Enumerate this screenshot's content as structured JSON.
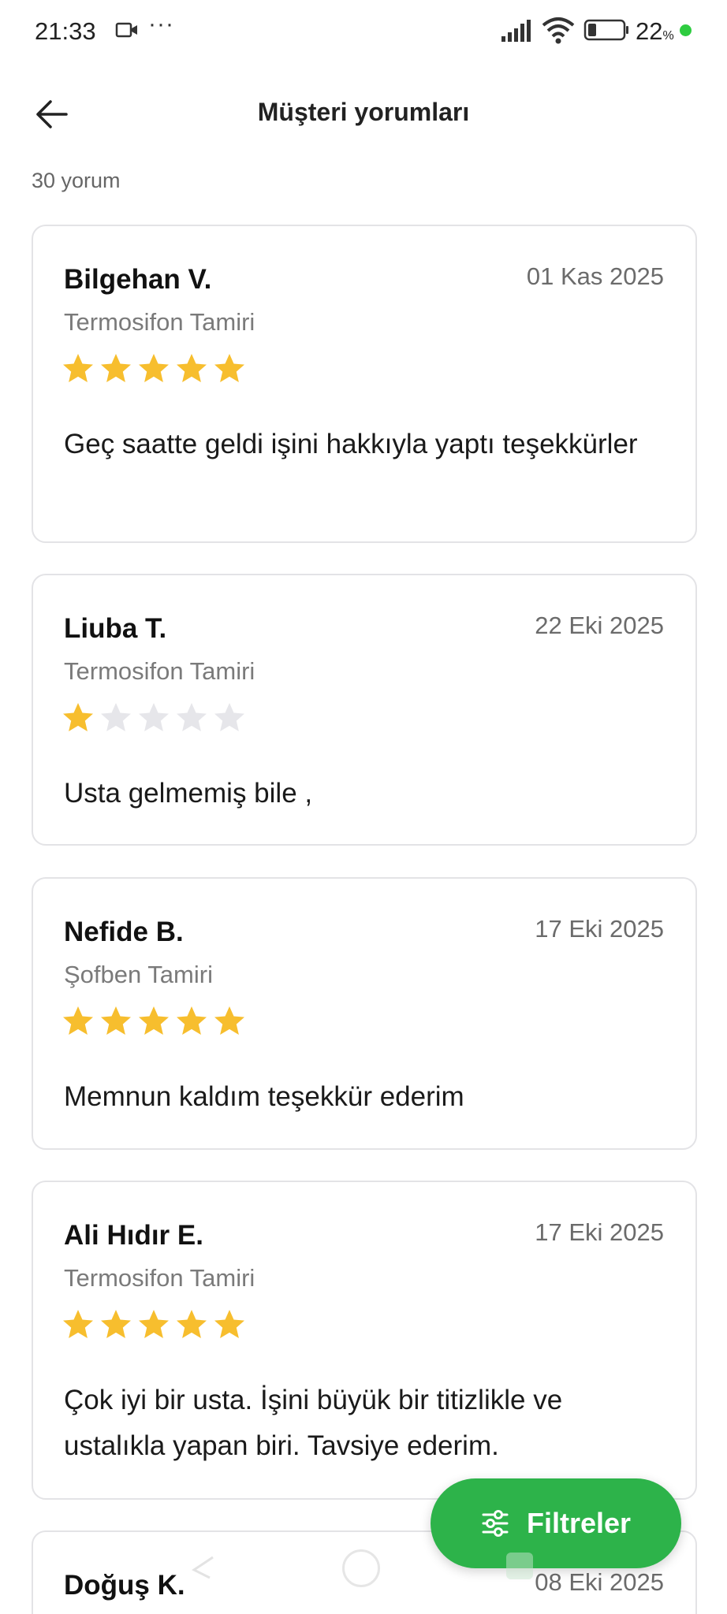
{
  "status_bar": {
    "time": "21:33",
    "dots": "···",
    "battery_percent": "22",
    "percent_sign": "%",
    "icons": [
      "video-icon",
      "signal-icon",
      "wifi-icon",
      "battery-icon"
    ]
  },
  "header": {
    "title": "Müşteri yorumları",
    "back_icon": "arrow-left-icon"
  },
  "review_count": "30 yorum",
  "reviews": [
    {
      "name": "Bilgehan V.",
      "date": "01 Kas 2025",
      "service": "Termosifon Tamiri",
      "rating": 5,
      "text": "Geç saatte geldi işini hakkıyla yaptı teşekkürler"
    },
    {
      "name": "Liuba T.",
      "date": "22 Eki 2025",
      "service": "Termosifon Tamiri",
      "rating": 1,
      "text": "Usta gelmemiş bile ,"
    },
    {
      "name": "Nefide B.",
      "date": "17 Eki 2025",
      "service": "Şofben Tamiri",
      "rating": 5,
      "text": "Memnun kaldım teşekkür ederim"
    },
    {
      "name": "Ali Hıdır E.",
      "date": "17 Eki 2025",
      "service": "Termosifon Tamiri",
      "rating": 5,
      "text": "Çok iyi bir usta. İşini büyük bir titizlikle ve ustalıkla yapan biri. Tavsiye ederim."
    },
    {
      "name": "Doğuş K.",
      "date": "08 Eki 2025",
      "service": "",
      "rating": null,
      "text": ""
    }
  ],
  "filter_button": {
    "label": "Filtreler",
    "icon": "sliders-icon"
  },
  "colors": {
    "star_filled": "#f7be2e",
    "star_empty": "#e6e6ea",
    "accent_green": "#2db34a",
    "card_border": "#e3e3e6"
  }
}
